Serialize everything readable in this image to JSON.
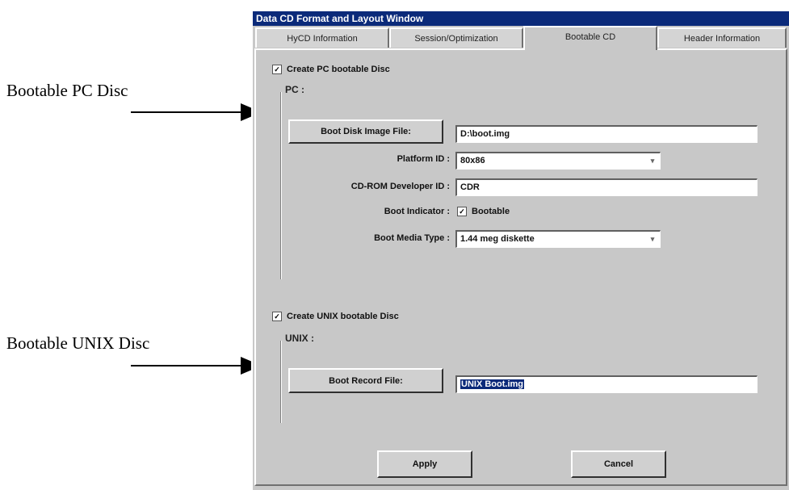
{
  "callouts": {
    "pc": "Bootable PC Disc",
    "unix": "Bootable UNIX Disc"
  },
  "window": {
    "title": "Data CD Format and Layout Window",
    "tabs": [
      "HyCD Information",
      "Session/Optimization",
      "Bootable CD",
      "Header Information"
    ],
    "active_tab": "Bootable CD"
  },
  "pc": {
    "create_checked": true,
    "create_label": "Create PC bootable Disc",
    "group_label": "PC :",
    "boot_image_button": "Boot Disk Image File:",
    "boot_image_value": "D:\\boot.img",
    "platform_label": "Platform ID :",
    "platform_value": "80x86",
    "developer_label": "CD-ROM Developer ID :",
    "developer_value": "CDR",
    "indicator_label": "Boot Indicator :",
    "indicator_checked": true,
    "indicator_check_label": "Bootable",
    "media_label": "Boot Media Type :",
    "media_value": "1.44 meg diskette"
  },
  "unix": {
    "create_checked": true,
    "create_label": "Create UNIX bootable Disc",
    "group_label": "UNIX :",
    "boot_record_button": "Boot Record File:",
    "boot_record_value": "UNIX Boot.img"
  },
  "buttons": {
    "apply": "Apply",
    "cancel": "Cancel"
  },
  "icons": {
    "checkmark": "check-icon",
    "dropdown": "dropdown-arrow-icon",
    "callout_arrow": "arrow-right-icon"
  }
}
